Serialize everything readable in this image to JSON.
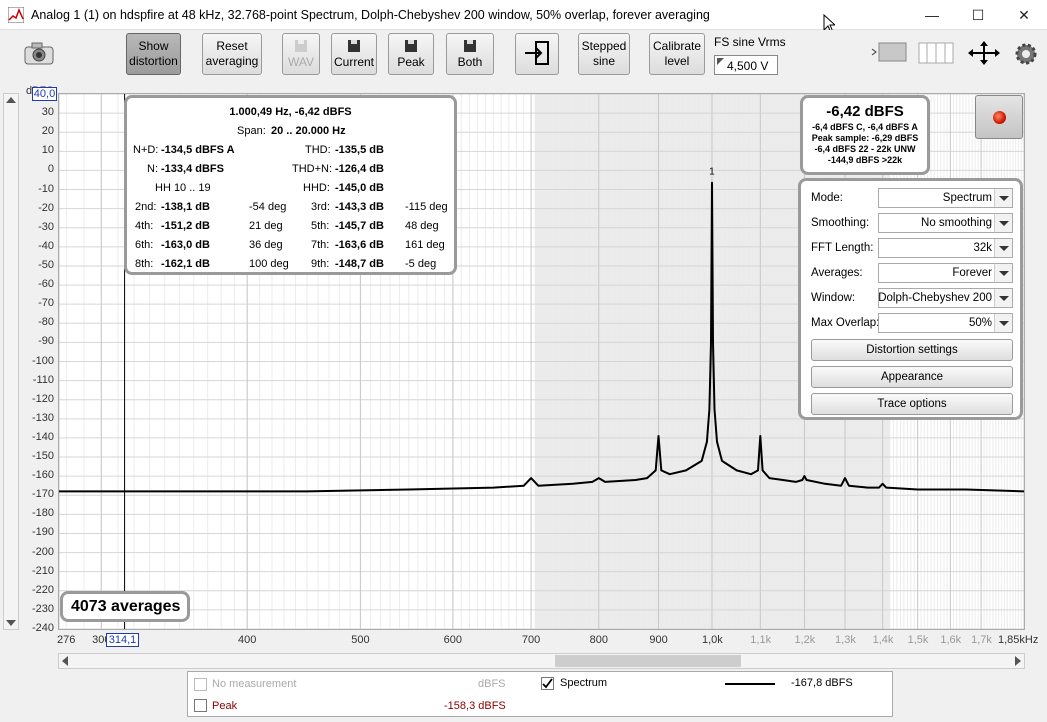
{
  "window": {
    "title": "Analog 1 (1) on hdspfire at 48 kHz, 32.768-point Spectrum, Dolph-Chebyshev 200 window, 50% overlap, forever averaging",
    "minimize": "—",
    "maximize": "☐",
    "close": "✕"
  },
  "toolbar": {
    "show_distortion": [
      "Show",
      "distortion"
    ],
    "reset_averaging": [
      "Reset",
      "averaging"
    ],
    "wav": "WAV",
    "current": "Current",
    "peak": "Peak",
    "both": "Both",
    "stepped_sine": [
      "Stepped",
      "sine"
    ],
    "calibrate_level": [
      "Calibrate",
      "level"
    ],
    "fs_label": "FS sine Vrms",
    "fs_value": "4,500 V"
  },
  "distortion": {
    "header": "1.000,49 Hz, -6,42 dBFS",
    "span_label": "Span:",
    "span_value": "20 .. 20.000 Hz",
    "nd_label": "N+D:",
    "nd_value": "-134,5 dBFS A",
    "thd_label": "THD:",
    "thd_value": "-135,5 dB",
    "n_label": "N:",
    "n_value": "-133,4 dBFS",
    "thdn_label": "THD+N:",
    "thdn_value": "-126,4 dB",
    "hh_label": "HH 10 .. 19",
    "hhd_label": "HHD:",
    "hhd_value": "-145,0 dB",
    "harmonics": [
      {
        "l1": "2nd:",
        "v1": "-138,1 dB",
        "d1": "-54 deg",
        "l2": "3rd:",
        "v2": "-143,3 dB",
        "d2": "-115 deg"
      },
      {
        "l1": "4th:",
        "v1": "-151,2 dB",
        "d1": "21 deg",
        "l2": "5th:",
        "v2": "-145,7 dB",
        "d2": "48 deg"
      },
      {
        "l1": "6th:",
        "v1": "-163,0 dB",
        "d1": "36 deg",
        "l2": "7th:",
        "v2": "-163,6 dB",
        "d2": "161 deg"
      },
      {
        "l1": "8th:",
        "v1": "-162,1 dB",
        "d1": "100 deg",
        "l2": "9th:",
        "v2": "-148,7 dB",
        "d2": "-5 deg"
      }
    ]
  },
  "level": {
    "main": "-6,42 dBFS",
    "line1": "-6,4 dBFS C, -6,4 dBFS A",
    "line2": "Peak sample: -6,29 dBFS",
    "line3": "-6,4 dBFS 22 - 22k UNW",
    "line4": "-144,9 dBFS >22k"
  },
  "controls": {
    "mode_label": "Mode:",
    "mode_value": "Spectrum",
    "smoothing_label": "Smoothing:",
    "smoothing_value": "No  smoothing",
    "fft_label": "FFT Length:",
    "fft_value": "32k",
    "averages_label": "Averages:",
    "averages_value": "Forever",
    "window_label": "Window:",
    "window_value": "Dolph-Chebyshev 200",
    "overlap_label": "Max Overlap:",
    "overlap_value": "50%",
    "distortion_settings": "Distortion settings",
    "appearance": "Appearance",
    "trace_options": "Trace options"
  },
  "averages_badge": "4073 averages",
  "cursor": {
    "x_readout": "314,1",
    "y_readout": "40,0"
  },
  "legend": {
    "no_measurement": "No measurement",
    "no_measurement_unit": "dBFS",
    "spectrum": "Spectrum",
    "spectrum_value": "-167,8 dBFS",
    "peak": "Peak",
    "peak_value": "-158,3 dBFS"
  },
  "colors": {
    "trace": "#000000",
    "peak": "#8b0000",
    "accent": "#1f3bb3"
  },
  "chart_data": {
    "type": "line",
    "ylabel": "dBFS",
    "xlabel": "",
    "x_scale": "log",
    "xlim": [
      276,
      1850
    ],
    "ylim": [
      -240,
      40
    ],
    "grid": true,
    "y_ticks": [
      30,
      20,
      10,
      0,
      -10,
      -20,
      -30,
      -40,
      -50,
      -60,
      -70,
      -80,
      -90,
      -100,
      -110,
      -120,
      -130,
      -140,
      -150,
      -160,
      -170,
      -180,
      -190,
      -200,
      -210,
      -220,
      -230
    ],
    "y_min_label": "-240",
    "x_tick_labels": [
      {
        "v": 276,
        "t": "276"
      },
      {
        "v": 300,
        "t": "300"
      },
      {
        "v": 400,
        "t": "400"
      },
      {
        "v": 500,
        "t": "500"
      },
      {
        "v": 600,
        "t": "600"
      },
      {
        "v": 700,
        "t": "700"
      },
      {
        "v": 800,
        "t": "800"
      },
      {
        "v": 900,
        "t": "900"
      },
      {
        "v": 1000,
        "t": "1,0k"
      },
      {
        "v": 1100,
        "t": "1,1k"
      },
      {
        "v": 1200,
        "t": "1,2k"
      },
      {
        "v": 1300,
        "t": "1,3k"
      },
      {
        "v": 1400,
        "t": "1,4k"
      },
      {
        "v": 1500,
        "t": "1,5k"
      },
      {
        "v": 1600,
        "t": "1,6k"
      },
      {
        "v": 1700,
        "t": "1,7k"
      },
      {
        "v": 1850,
        "t": "1,85kHz"
      }
    ],
    "shaded_range": [
      705,
      1420
    ],
    "peak_marker": {
      "x": 1000,
      "label": "1"
    },
    "series": [
      {
        "x": [
          276,
          350,
          450,
          550,
          650,
          690,
          700,
          710,
          760,
          790,
          800,
          810,
          860,
          880,
          895,
          900,
          905,
          920,
          950,
          980,
          990,
          995,
          998,
          1000,
          1002,
          1005,
          1010,
          1020,
          1050,
          1080,
          1095,
          1100,
          1105,
          1120,
          1150,
          1180,
          1195,
          1200,
          1205,
          1250,
          1290,
          1300,
          1310,
          1360,
          1390,
          1400,
          1410,
          1500,
          1650,
          1850
        ],
        "y": [
          -168,
          -168,
          -168,
          -167,
          -166,
          -165,
          -161,
          -165,
          -164,
          -163,
          -161,
          -163,
          -162,
          -161,
          -157,
          -139,
          -157,
          -159,
          -157,
          -152,
          -142,
          -125,
          -90,
          -6.4,
          -90,
          -125,
          -142,
          -152,
          -157,
          -159,
          -157,
          -139,
          -157,
          -161,
          -162,
          -163,
          -162,
          -160,
          -162,
          -164,
          -165,
          -161,
          -165,
          -166,
          -166,
          -164,
          -166,
          -167,
          -167,
          -168
        ]
      }
    ]
  }
}
